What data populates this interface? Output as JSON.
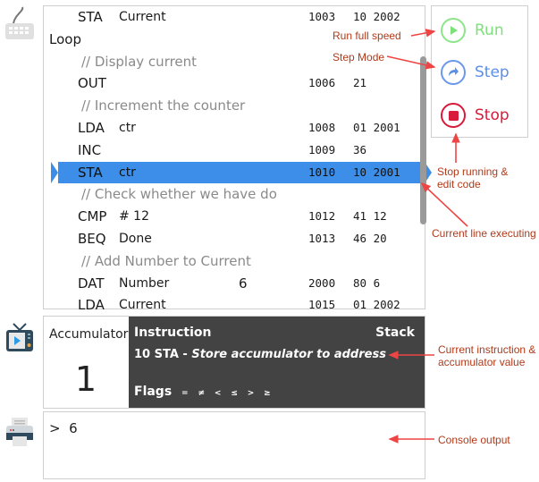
{
  "editor": {
    "lines": [
      {
        "type": "instr",
        "op": "STA",
        "arg": "Current",
        "val": "",
        "addr": "1003",
        "code": "10 2002"
      },
      {
        "type": "label",
        "text": "Loop"
      },
      {
        "type": "comment",
        "text": "// Display current"
      },
      {
        "type": "instr",
        "op": "OUT",
        "arg": "",
        "val": "",
        "addr": "1006",
        "code": "21"
      },
      {
        "type": "comment",
        "text": "// Increment the counter"
      },
      {
        "type": "instr",
        "op": "LDA",
        "arg": "ctr",
        "val": "",
        "addr": "1008",
        "code": "01 2001"
      },
      {
        "type": "instr",
        "op": "INC",
        "arg": "",
        "val": "",
        "addr": "1009",
        "code": "36"
      },
      {
        "type": "current",
        "op": "STA",
        "arg": "ctr",
        "val": "",
        "addr": "1010",
        "code": "10 2001"
      },
      {
        "type": "comment",
        "text": "// Check whether we have do"
      },
      {
        "type": "instr",
        "op": "CMP",
        "arg": "# 12",
        "val": "",
        "addr": "1012",
        "code": "41 12"
      },
      {
        "type": "instr",
        "op": "BEQ",
        "arg": "Done",
        "val": "",
        "addr": "1013",
        "code": "46 20"
      },
      {
        "type": "comment",
        "text": "// Add Number to Current"
      },
      {
        "type": "instr",
        "op": "DAT",
        "arg": "Number",
        "val": "6",
        "addr": "2000",
        "code": "80 6"
      },
      {
        "type": "instr",
        "op": "LDA",
        "arg": "Current",
        "val": "",
        "addr": "1015",
        "code": "01 2002"
      }
    ]
  },
  "controls": {
    "run_label": "Run",
    "step_label": "Step",
    "stop_label": "Stop",
    "colors": {
      "run": "#7ee07a",
      "step": "#5b8fe8",
      "stop": "#d81b3a"
    }
  },
  "status": {
    "accumulator_label": "Accumulator",
    "accumulator_value": "1",
    "instruction_label": "Instruction",
    "stack_label": "Stack",
    "instruction_code": "10 STA - ",
    "instruction_desc": "Store accumulator to address",
    "flags_label": "Flags",
    "flags": [
      "=",
      "≠",
      "<",
      "≤",
      ">",
      "≥"
    ]
  },
  "console": {
    "output": ">  6"
  },
  "annotations": {
    "run": "Run full speed",
    "step": "Step Mode",
    "stop": "Stop running & edit code",
    "current_line": "Current line executing",
    "instruction": "Current instruction & accumulator value",
    "console": "Console output"
  },
  "icons": {
    "editor": "keyboard-icon",
    "status": "tv-icon",
    "console": "printer-icon"
  }
}
